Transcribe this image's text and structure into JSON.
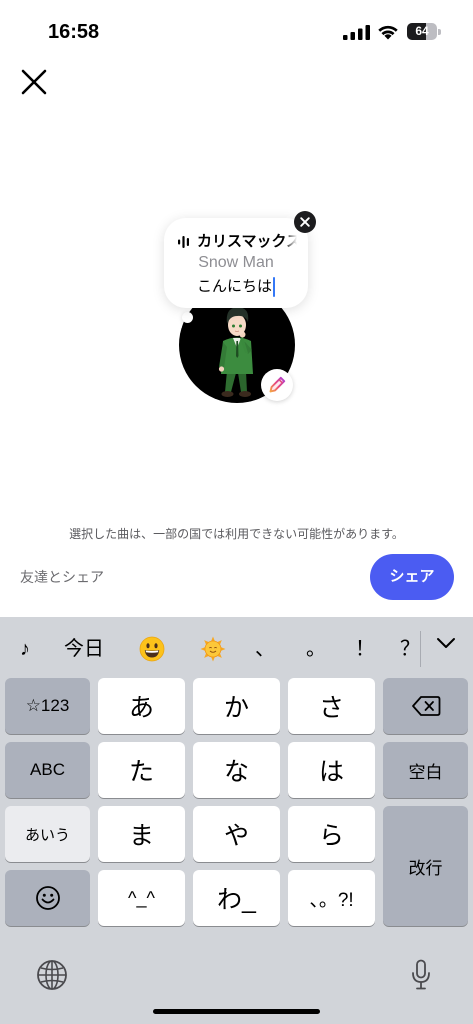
{
  "status_bar": {
    "time": "16:58",
    "battery_level": "64",
    "signal_icon": "cellular-signal-icon",
    "wifi_icon": "wifi-icon",
    "battery_icon": "battery-icon"
  },
  "header": {
    "close_icon": "close-icon"
  },
  "note_bubble": {
    "music_icon": "music-bars-icon",
    "song_title": "カリスマックス",
    "artist": "Snow Man",
    "note_text": "こんにちは",
    "remove_icon": "close-circle-icon"
  },
  "profile": {
    "edit_icon": "pencil-icon"
  },
  "notice": "選択した曲は、一部の国では利用できない可能性があります。",
  "share": {
    "friends_label": "友達とシェア",
    "button_label": "シェア"
  },
  "keyboard": {
    "suggestions": {
      "note": "♪",
      "today": "今日",
      "emoji_1_icon": "grinning-face-icon",
      "emoji_2_icon": "sun-with-face-icon",
      "comma": "、",
      "period": "。",
      "exclamation": "！",
      "question": "？",
      "collapse_icon": "chevron-down-icon"
    },
    "keys": {
      "numbers": "☆123",
      "a": "あ",
      "ka": "か",
      "sa": "さ",
      "backspace_icon": "backspace-icon",
      "abc": "ABC",
      "ta": "た",
      "na": "な",
      "ha": "は",
      "space": "空白",
      "kana": "あいう",
      "ma": "ま",
      "ya": "や",
      "ra": "ら",
      "return": "改行",
      "emoji_icon": "smiley-icon",
      "kaomoji": "^_^",
      "wa": "わ_",
      "punctuation": "、。?!"
    },
    "bottom": {
      "globe_icon": "globe-icon",
      "mic_icon": "microphone-icon"
    }
  },
  "colors": {
    "accent": "#4b5cf2",
    "cursor": "#3478f6",
    "keyboard_bg": "#d1d4d9"
  }
}
